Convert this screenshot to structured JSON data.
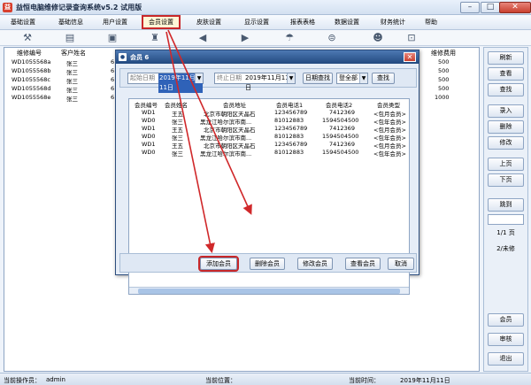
{
  "app": {
    "title": "益恒电脑维修记录查询系统v5.2 试用版"
  },
  "menu": [
    "基础设置",
    "基础信息",
    "用户设置",
    "会员设置",
    "皮肤设置",
    "显示设置",
    "报表表格",
    "数据设置",
    "财务统计",
    "帮助"
  ],
  "toolbar_icons": [
    "tool-icon",
    "printer-icon",
    "computer-icon",
    "member-icon",
    "arrow-left-icon",
    "arrow-right-icon",
    "umbrella-icon",
    "gauge-icon",
    "users-icon",
    "exit-icon"
  ],
  "main_table": {
    "headers": [
      "维修编号",
      "客户姓名",
      "维修费用"
    ],
    "rows": [
      {
        "id": "WD1055568a",
        "name": "张三",
        "col3": "6",
        "fee": "500"
      },
      {
        "id": "WD1055568b",
        "name": "张三",
        "col3": "6",
        "fee": "500"
      },
      {
        "id": "WD1055568c",
        "name": "张三",
        "col3": "6",
        "fee": "500"
      },
      {
        "id": "WD1055568d",
        "name": "张三",
        "col3": "6",
        "fee": "500"
      },
      {
        "id": "WD1055568e",
        "name": "张三",
        "col3": "6",
        "fee": "1000"
      }
    ]
  },
  "right_panel": {
    "buttons_top": [
      "刷新",
      "查看",
      "查找",
      "录入",
      "删除",
      "修改",
      "上页",
      "下页",
      "跳到"
    ],
    "page_info": "1/1 页",
    "pending": "2/未修",
    "buttons_bottom": [
      "会员",
      "审核",
      "退出"
    ]
  },
  "status": {
    "operator_label": "当前操作员：",
    "operator": "admin",
    "position_label": "当前位置：",
    "time_label": "当前时间：",
    "date": "2019年11月11日"
  },
  "dialog": {
    "title": "会员 6",
    "start_label": "起始日期",
    "start_value": "2019年11月11日",
    "end_label": "终止日期",
    "end_value": "2019年11月11日",
    "date_search": "日期查找",
    "type_value": "登全部",
    "search": "查找",
    "headers": [
      "会员编号",
      "会员姓名",
      "会员地址",
      "会员电话1",
      "会员电话2",
      "会员类型"
    ],
    "rows": [
      {
        "id": "WD1",
        "name": "王五",
        "address": "北京市朝阳区天晶石",
        "phone1": "123456789",
        "phone2": "7412369",
        "type": "<包月会员>"
      },
      {
        "id": "WD0",
        "name": "张三",
        "address": "黑龙江哈尔滨市南...",
        "phone1": "81012883",
        "phone2": "1594504500",
        "type": "<包年会员>"
      },
      {
        "id": "WD1",
        "name": "王五",
        "address": "北京市朝阳区天晶石",
        "phone1": "123456789",
        "phone2": "7412369",
        "type": "<包月会员>"
      },
      {
        "id": "WD0",
        "name": "张三",
        "address": "黑龙江哈尔滨市南...",
        "phone1": "81012883",
        "phone2": "1594504500",
        "type": "<包年会员>"
      },
      {
        "id": "WD1",
        "name": "王五",
        "address": "北京市朝阳区天晶石",
        "phone1": "123456789",
        "phone2": "7412369",
        "type": "<包月会员>"
      },
      {
        "id": "WD0",
        "name": "张三",
        "address": "黑龙江哈尔滨市南...",
        "phone1": "81012883",
        "phone2": "1594504500",
        "type": "<包年会员>"
      }
    ],
    "actions": [
      "添加会员",
      "删除会员",
      "修改会员",
      "查看会员",
      "取消"
    ]
  },
  "colors": {
    "highlight": "#c8282a",
    "dialog_title": "#22497f"
  }
}
